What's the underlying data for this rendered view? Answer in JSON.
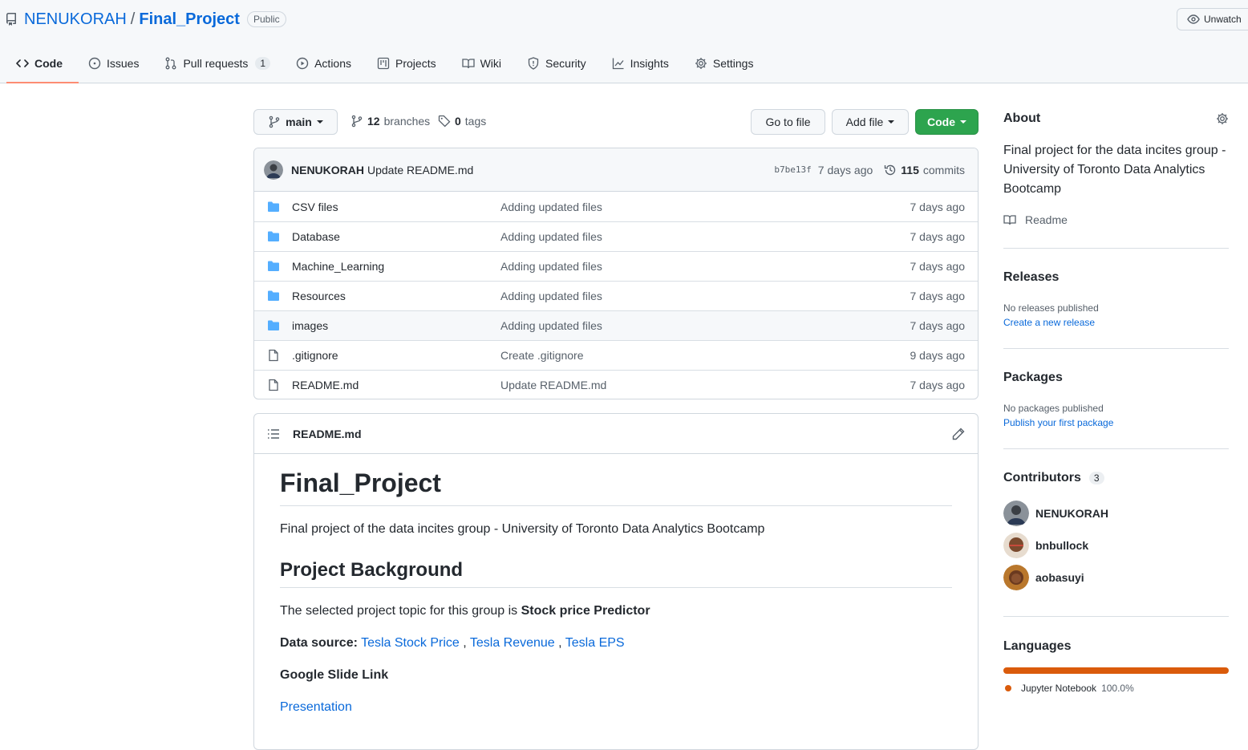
{
  "repo": {
    "owner": "NENUKORAH",
    "separator": "/",
    "name": "Final_Project",
    "visibility": "Public"
  },
  "watch": {
    "label": "Unwatch"
  },
  "tabs": [
    {
      "label": "Code",
      "icon": "code-icon",
      "selected": true
    },
    {
      "label": "Issues",
      "icon": "issue-icon"
    },
    {
      "label": "Pull requests",
      "icon": "pull-request-icon",
      "count": "1"
    },
    {
      "label": "Actions",
      "icon": "play-icon"
    },
    {
      "label": "Projects",
      "icon": "project-icon"
    },
    {
      "label": "Wiki",
      "icon": "book-icon"
    },
    {
      "label": "Security",
      "icon": "shield-icon"
    },
    {
      "label": "Insights",
      "icon": "graph-icon"
    },
    {
      "label": "Settings",
      "icon": "gear-icon"
    }
  ],
  "toolbar": {
    "branch": "main",
    "branches_count": "12",
    "branches_label": "branches",
    "tags_count": "0",
    "tags_label": "tags",
    "go_to_file": "Go to file",
    "add_file": "Add file",
    "code": "Code"
  },
  "commit": {
    "author": "NENUKORAH",
    "message": "Update README.md",
    "sha": "b7be13f",
    "age": "7 days ago",
    "commits_count": "115",
    "commits_label": "commits"
  },
  "files": [
    {
      "type": "folder",
      "name": "CSV files",
      "message": "Adding updated files",
      "age": "7 days ago"
    },
    {
      "type": "folder",
      "name": "Database",
      "message": "Adding updated files",
      "age": "7 days ago"
    },
    {
      "type": "folder",
      "name": "Machine_Learning",
      "message": "Adding updated files",
      "age": "7 days ago"
    },
    {
      "type": "folder",
      "name": "Resources",
      "message": "Adding updated files",
      "age": "7 days ago"
    },
    {
      "type": "folder",
      "name": "images",
      "message": "Adding updated files",
      "age": "7 days ago"
    },
    {
      "type": "file",
      "name": ".gitignore",
      "message": "Create .gitignore",
      "age": "9 days ago"
    },
    {
      "type": "file",
      "name": "README.md",
      "message": "Update README.md",
      "age": "7 days ago"
    }
  ],
  "readme": {
    "filename": "README.md",
    "title": "Final_Project",
    "intro": "Final project of the data incites group - University of Toronto Data Analytics Bootcamp",
    "h2": "Project Background",
    "topic_text": "The selected project topic for this group is ",
    "topic_bold": "Stock price Predictor",
    "datasource_label": "Data source:",
    "links": [
      "Tesla Stock Price",
      "Tesla Revenue",
      "Tesla EPS"
    ],
    "link_separator": ",",
    "slide_label": "Google Slide Link",
    "presentation": "Presentation"
  },
  "about": {
    "title": "About",
    "description": "Final project for the data incites group - University of Toronto Data Analytics Bootcamp",
    "readme": "Readme"
  },
  "releases": {
    "title": "Releases",
    "empty": "No releases published",
    "link": "Create a new release"
  },
  "packages": {
    "title": "Packages",
    "empty": "No packages published",
    "link": "Publish your first package"
  },
  "contributors": {
    "title": "Contributors",
    "count": "3",
    "people": [
      "NENUKORAH",
      "bnbullock",
      "aobasuyi"
    ]
  },
  "languages": {
    "title": "Languages",
    "items": [
      {
        "name": "Jupyter Notebook",
        "percent": "100.0%",
        "color": "#DA5B0B"
      }
    ]
  },
  "colors": {
    "accent": "#0969da",
    "primary_button": "#2da44e",
    "folder": "#54aeff",
    "tab_underline": "#fd8c73"
  }
}
